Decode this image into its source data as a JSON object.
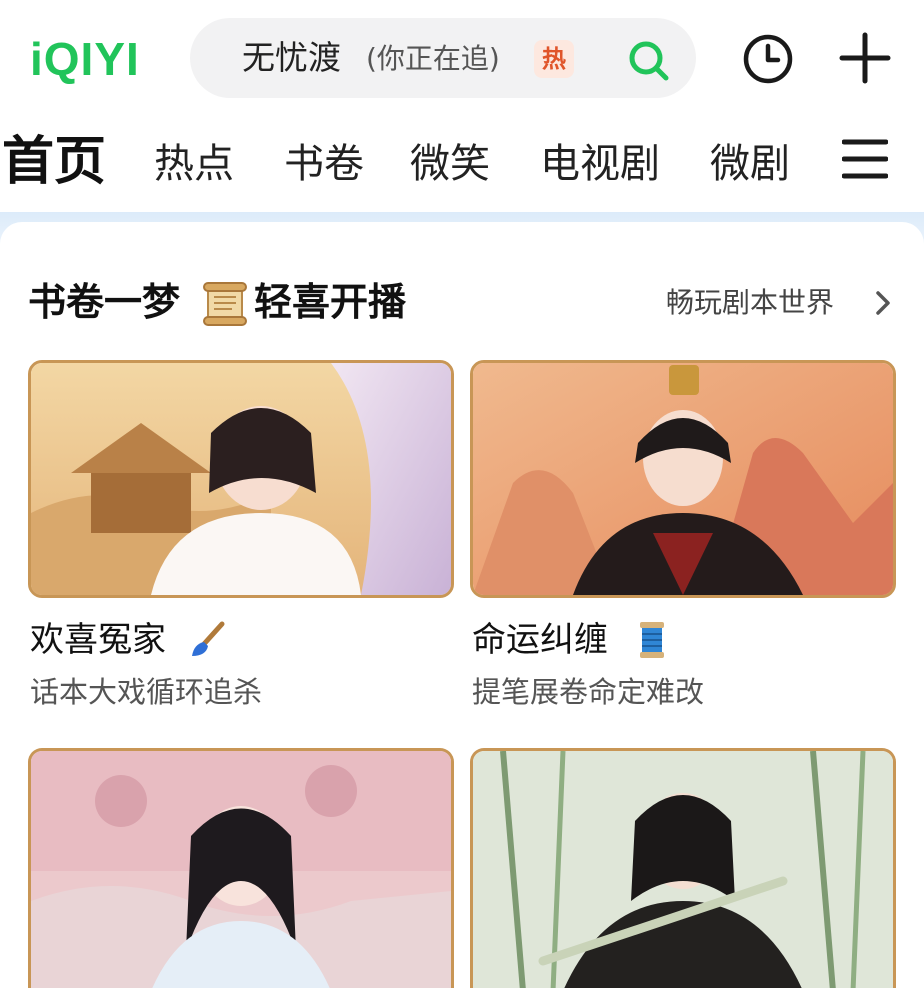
{
  "header": {
    "logo": "iQIYI",
    "search": {
      "text": "无忧渡",
      "subtext": "(你正在追)",
      "badge": "热"
    }
  },
  "tabs": [
    {
      "label": "首页",
      "active": true
    },
    {
      "label": "热点"
    },
    {
      "label": "书卷"
    },
    {
      "label": "微笑"
    },
    {
      "label": "电视剧"
    },
    {
      "label": "微剧"
    }
  ],
  "section": {
    "title_part1": "书卷一梦",
    "title_part2": "轻喜开播",
    "more": "畅玩剧本世界"
  },
  "cards": [
    {
      "title": "欢喜冤家",
      "subtitle": "话本大戏循环追杀",
      "emoji": "paintbrush-icon"
    },
    {
      "title": "命运纠缠",
      "subtitle": "提笔展卷命定难改",
      "emoji": "thread-spool-icon"
    },
    {
      "title": "",
      "subtitle": ""
    },
    {
      "title": "",
      "subtitle": ""
    }
  ],
  "colors": {
    "brand": "#21c45a",
    "hot": "#e0552a",
    "frame": "#c89656"
  }
}
